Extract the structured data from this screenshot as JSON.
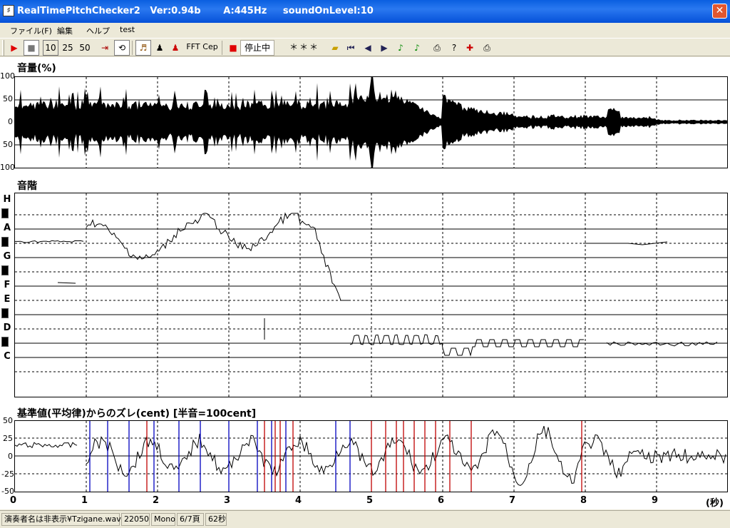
{
  "window": {
    "title": "RealTimePitchChecker2   Ver:0.94b       A:445Hz     soundOnLevel:10",
    "close": "✕",
    "icon": "♯"
  },
  "menu": [
    "ファイル(F)",
    "編集",
    "ヘルプ",
    "test"
  ],
  "toolbar": {
    "speed": [
      "10",
      "25",
      "50"
    ],
    "labels": {
      "fft": "FFT",
      "cep": "Cep",
      "status": "停止中",
      "stars": "＊＊＊"
    }
  },
  "panels": {
    "volume": {
      "title": "音量(%)",
      "ticks": [
        "100",
        "50",
        "0",
        "50",
        "100"
      ]
    },
    "scale": {
      "title": "音階",
      "notes": [
        "H",
        "A",
        "G",
        "F",
        "E",
        "D",
        "C"
      ]
    },
    "deviation": {
      "title": "基準値(平均律)からのズレ(cent) [半音=100cent]",
      "ticks": [
        "50",
        "25",
        "0",
        "-25",
        "-50"
      ]
    }
  },
  "axis": {
    "x_labels": [
      "0",
      "1",
      "2",
      "3",
      "4",
      "5",
      "6",
      "7",
      "8",
      "9"
    ],
    "unit": "(秒)"
  },
  "statusbar": [
    "演奏者名は非表示¥Tzigane.wav",
    "22050",
    "Mono",
    "6/7頁",
    "62秒"
  ]
}
